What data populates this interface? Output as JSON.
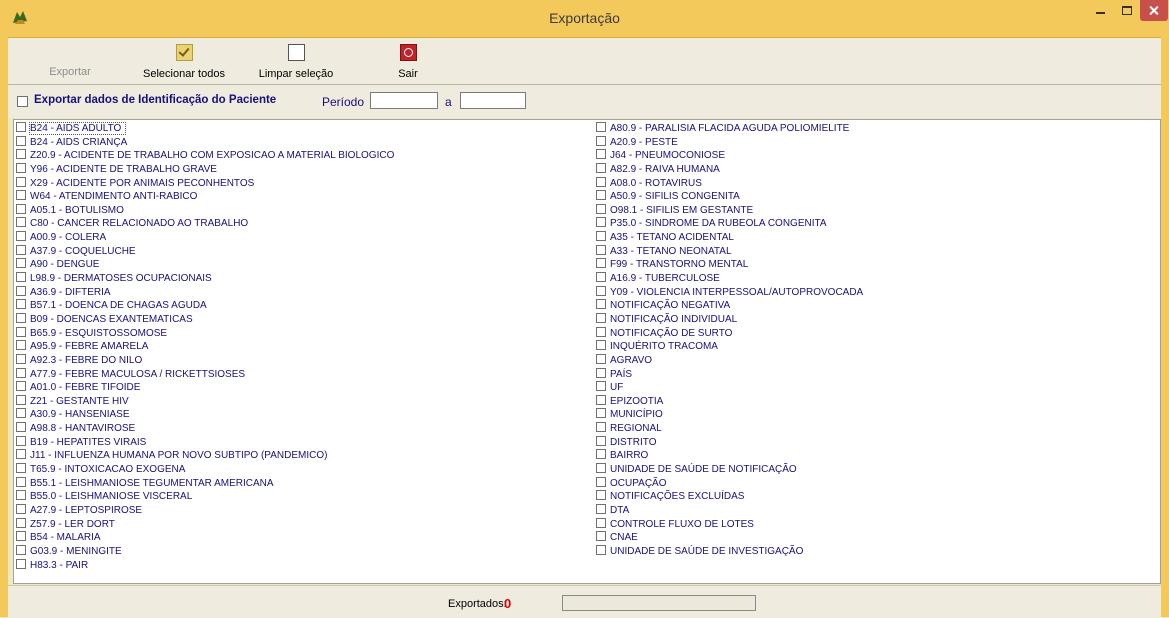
{
  "window": {
    "title": "Exportação",
    "icon": "app-icon",
    "controls": [
      "minimize-icon",
      "maximize-icon",
      "close-icon"
    ]
  },
  "toolbar": {
    "export_label": "Exportar",
    "select_all_label": "Selecionar todos",
    "clear_label": "Limpar seleção",
    "exit_label": "Sair"
  },
  "filters": {
    "id_label": "Exportar dados de Identificação do Paciente",
    "id_checked": false,
    "periodo_label": "Período",
    "periodo_start": "",
    "periodo_sep": "a",
    "periodo_end": ""
  },
  "list": {
    "left": [
      "B24 - AIDS ADULTO",
      "B24 - AIDS CRIANÇA",
      "Z20.9 - ACIDENTE DE TRABALHO COM EXPOSICAO A MATERIAL BIOLOGICO",
      "Y96 - ACIDENTE DE TRABALHO GRAVE",
      "X29 - ACIDENTE POR ANIMAIS PECONHENTOS",
      "W64 - ATENDIMENTO ANTI-RABICO",
      "A05.1 - BOTULISMO",
      "C80 - CANCER RELACIONADO AO TRABALHO",
      "A00.9 - COLERA",
      "A37.9 - COQUELUCHE",
      "A90 - DENGUE",
      "L98.9 - DERMATOSES OCUPACIONAIS",
      "A36.9 - DIFTERIA",
      "B57.1 - DOENCA DE CHAGAS AGUDA",
      "B09 - DOENCAS EXANTEMATICAS",
      "B65.9 - ESQUISTOSSOMOSE",
      "A95.9 - FEBRE AMARELA",
      "A92.3 - FEBRE DO NILO",
      "A77.9 - FEBRE MACULOSA / RICKETTSIOSES",
      "A01.0 - FEBRE TIFOIDE",
      "Z21 - GESTANTE HIV",
      "A30.9 - HANSENIASE",
      "A98.8 - HANTAVIROSE",
      "B19 - HEPATITES VIRAIS",
      "J11 - INFLUENZA HUMANA POR NOVO SUBTIPO (PANDEMICO)",
      "T65.9 - INTOXICACAO EXOGENA",
      "B55.1 - LEISHMANIOSE TEGUMENTAR AMERICANA",
      "B55.0 - LEISHMANIOSE VISCERAL",
      "A27.9 - LEPTOSPIROSE",
      "Z57.9 - LER DORT",
      "B54 - MALARIA",
      "G03.9 - MENINGITE",
      "H83.3 - PAIR"
    ],
    "right": [
      "A80.9 - PARALISIA FLACIDA AGUDA  POLIOMIELITE",
      "A20.9 - PESTE",
      "J64 - PNEUMOCONIOSE",
      "A82.9 - RAIVA HUMANA",
      "A08.0 - ROTAVIRUS",
      "A50.9 - SIFILIS CONGENITA",
      "O98.1 - SIFILIS EM GESTANTE",
      "P35.0 - SINDROME DA RUBEOLA CONGENITA",
      "A35 - TETANO ACIDENTAL",
      "A33 - TETANO NEONATAL",
      "F99 - TRANSTORNO MENTAL",
      "A16.9 - TUBERCULOSE",
      "Y09 - VIOLENCIA INTERPESSOAL/AUTOPROVOCADA",
      "NOTIFICAÇÃO NEGATIVA",
      "NOTIFICAÇÃO INDIVIDUAL",
      "NOTIFICAÇÃO DE SURTO",
      "INQUÉRITO TRACOMA",
      "AGRAVO",
      "PAÍS",
      "UF",
      "EPIZOOTIA",
      "MUNICÍPIO",
      "REGIONAL",
      "DISTRITO",
      "BAIRRO",
      "UNIDADE DE SAÚDE DE NOTIFICAÇÃO",
      "OCUPAÇÃO",
      "NOTIFICAÇÕES EXCLUÍDAS",
      "DTA",
      "CONTROLE FLUXO DE LOTES",
      "CNAE",
      "UNIDADE DE SAÚDE DE INVESTIGAÇÃO"
    ]
  },
  "status": {
    "exported_label": "Exportados:",
    "exported_count": "0",
    "progress": 0
  },
  "colors": {
    "title_bar": "#f2c95a",
    "item_text": "#17117a",
    "count": "#e00000"
  }
}
